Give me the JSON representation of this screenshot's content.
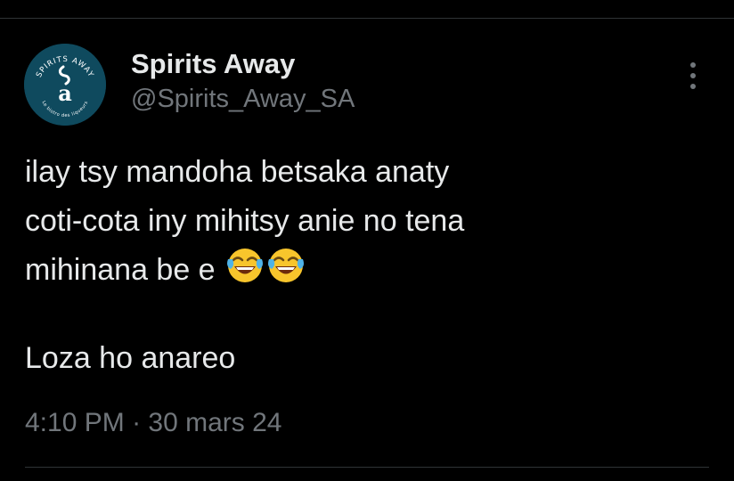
{
  "tweet": {
    "author": {
      "display_name": "Spirits Away",
      "handle": "@Spirits_Away_SA",
      "avatar": {
        "icon": "spirits-away-logo",
        "logo_text_top": "SPIRITS AWAY",
        "logo_text_bottom": "Le bistro des liqueurs",
        "background_color": "#0f4a5e"
      }
    },
    "text_lines": [
      "ilay tsy mandoha betsaka anaty",
      "coti-cota iny mihitsy anie no tena",
      "mihinana be e"
    ],
    "emojis": [
      "face-with-tears-of-joy-icon",
      "face-with-tears-of-joy-icon"
    ],
    "text_after_break": "Loza ho anareo",
    "time": "4:10 PM",
    "separator": "·",
    "date": "30 mars 24",
    "more_menu_icon": "vertical-ellipsis-icon"
  },
  "colors": {
    "background": "#000000",
    "primary_text": "#e7e9ea",
    "secondary_text": "#71767b",
    "divider": "#2f3336"
  }
}
